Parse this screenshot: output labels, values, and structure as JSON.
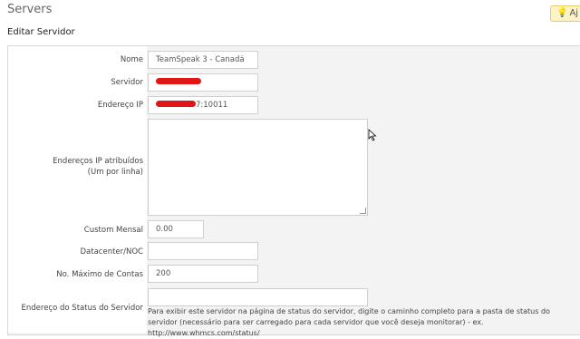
{
  "header": {
    "title": "Servers",
    "help_label": "Aj"
  },
  "section": {
    "title": "Editar Servidor"
  },
  "form": {
    "name": {
      "label": "Nome",
      "value": "TeamSpeak 3 - Canadá"
    },
    "server": {
      "label": "Servidor",
      "value": ""
    },
    "ip": {
      "label": "Endereço IP",
      "value_suffix": "7:10011"
    },
    "assigned_ips": {
      "label_line1": "Endereços IP atribuídos",
      "label_line2": "(Um por linha)",
      "value": ""
    },
    "monthly_cost": {
      "label": "Custom Mensal",
      "value": "0.00"
    },
    "datacenter": {
      "label": "Datacenter/NOC",
      "value": ""
    },
    "max_accounts": {
      "label": "No. Máximo de Contas",
      "value": "200"
    },
    "status_address": {
      "label": "Endereço do Status do Servidor",
      "value": "",
      "help": "Para exibir este servidor na página de status do servidor, digite o caminho completo para a pasta de status do servidor (necessário para ser carregado para cada servidor que você deseja monitorar) - ex. http://www.whmcs.com/status/"
    }
  },
  "colors": {
    "redaction": "#e01616",
    "help_bg": "#fdf3c4"
  }
}
